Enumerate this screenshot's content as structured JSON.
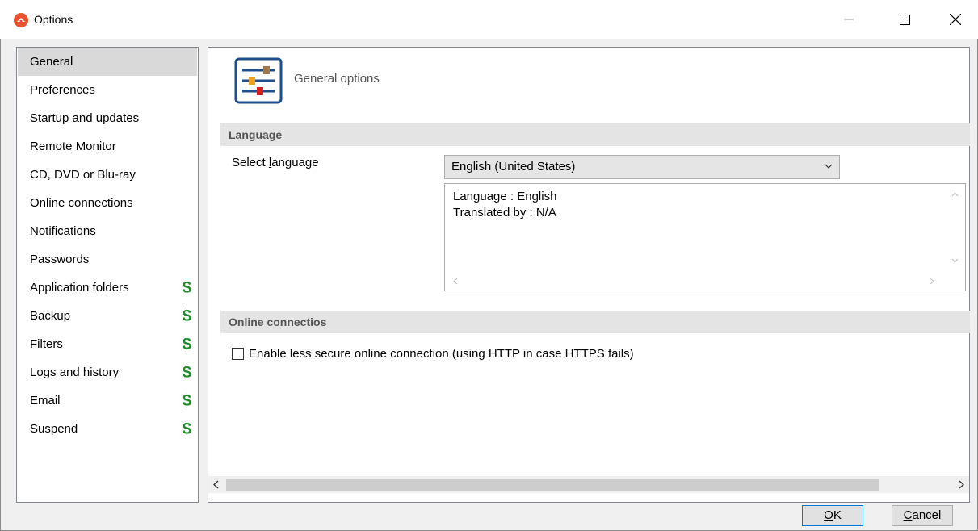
{
  "window": {
    "title": "Options"
  },
  "sidebar": {
    "items": [
      {
        "label": "General",
        "selected": true,
        "premium": false
      },
      {
        "label": "Preferences",
        "premium": false
      },
      {
        "label": "Startup and updates",
        "premium": false
      },
      {
        "label": "Remote Monitor",
        "premium": false
      },
      {
        "label": "CD, DVD or Blu-ray",
        "premium": false
      },
      {
        "label": "Online connections",
        "premium": false
      },
      {
        "label": "Notifications",
        "premium": false
      },
      {
        "label": "Passwords",
        "premium": false
      },
      {
        "label": "Application folders",
        "premium": true
      },
      {
        "label": "Backup",
        "premium": true
      },
      {
        "label": "Filters",
        "premium": true
      },
      {
        "label": "Logs and history",
        "premium": true
      },
      {
        "label": "Email",
        "premium": true
      },
      {
        "label": "Suspend",
        "premium": true
      }
    ],
    "premium_symbol": "$"
  },
  "content": {
    "header_title": "General options",
    "language_section": "Language",
    "select_language_prefix": "Select ",
    "select_language_mnemonic": "l",
    "select_language_suffix": "anguage",
    "language_value": "English (United States)",
    "info_line1": "Language : English",
    "info_line2": "Translated by : N/A",
    "online_section": "Online connectios",
    "checkbox_label": "Enable less secure online connection (using HTTP in case HTTPS fails)",
    "checkbox_checked": false
  },
  "buttons": {
    "ok_mnemonic": "O",
    "ok_rest": "K",
    "cancel_mnemonic": "C",
    "cancel_rest": "ancel"
  },
  "colors": {
    "accent": "#0078d7",
    "premium": "#1e8c2a",
    "app_icon": "#e8542d"
  }
}
